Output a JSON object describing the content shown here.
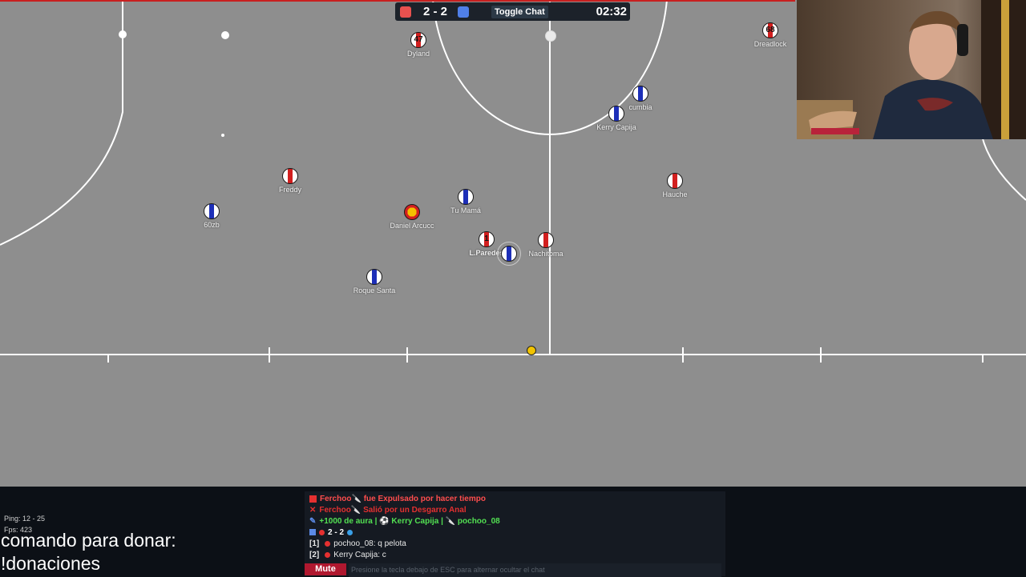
{
  "scoreboard": {
    "score": "2 - 2",
    "toggle_chat_label": "Toggle Chat",
    "time": "02:32",
    "red_color": "#e8514f",
    "blue_color": "#4f7fe8"
  },
  "players": [
    {
      "name": "Dyland",
      "team": "red",
      "number": "47"
    },
    {
      "name": "Dreadlock",
      "team": "red",
      "number": "68"
    },
    {
      "name": "cumbia",
      "team": "blue",
      "number": ""
    },
    {
      "name": "Kerry Capija",
      "team": "blue",
      "number": ""
    },
    {
      "name": "Freddy",
      "team": "red",
      "number": ""
    },
    {
      "name": "Hauche",
      "team": "red",
      "number": ""
    },
    {
      "name": "60zb",
      "team": "blue",
      "number": ""
    },
    {
      "name": "Tu Mamá",
      "team": "blue",
      "number": ""
    },
    {
      "name": "Daniel Arcucc",
      "team": "red",
      "number": ""
    },
    {
      "name": "L.Paredes",
      "team": "red",
      "number": "1"
    },
    {
      "name": "Nachitoma",
      "team": "red",
      "number": ""
    },
    {
      "name": "Roque Santa",
      "team": "blue",
      "number": ""
    }
  ],
  "stats": {
    "ping": "Ping: 12 - 25",
    "fps": "Fps: 423"
  },
  "donation": {
    "line1": "comando para donar:",
    "line2": "!donaciones"
  },
  "chat": {
    "messages": [
      {
        "icon": "red-square",
        "author": "Ferchoo",
        "text": "fue Expulsado por hacer tiempo"
      },
      {
        "icon": "red-x",
        "author": "Ferchoo",
        "text": "Salió por un Desgarro Anal"
      },
      {
        "text": "+1000 de aura | ⚽ Kerry Capija | 🔪 pochoo_08"
      },
      {
        "text": "2 - 2"
      },
      {
        "slot": "[1]",
        "text": "pochoo_08: q pelota"
      },
      {
        "slot": "[2]",
        "text": "Kerry Capija: c"
      }
    ],
    "mute_label": "Mute",
    "input_placeholder": "Presione la tecla debajo de ESC para alternar ocultar el chat"
  }
}
